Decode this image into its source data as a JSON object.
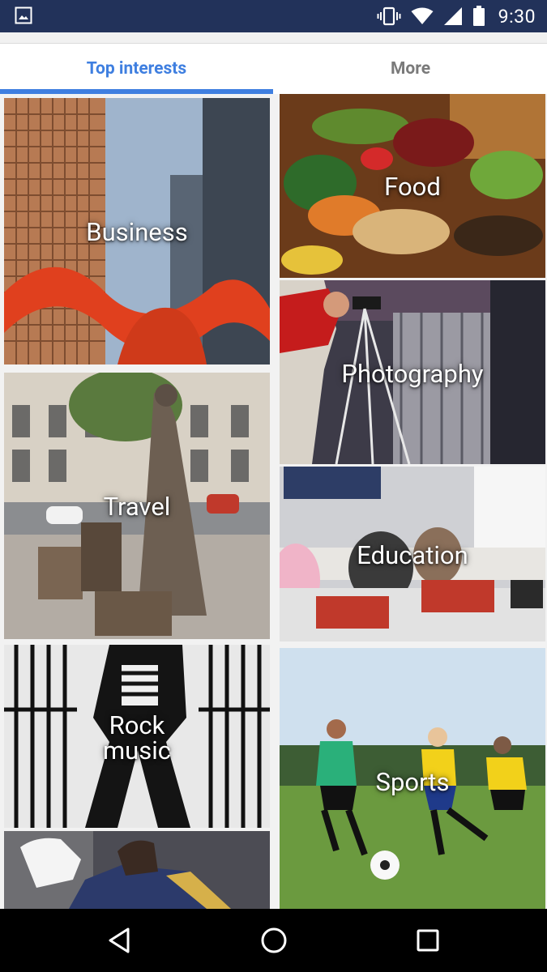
{
  "status_bar": {
    "time": "9:30",
    "left_icon": "image-notification-icon",
    "right_icons": [
      "vibrate-icon",
      "wifi-icon",
      "signal-icon",
      "battery-icon"
    ]
  },
  "tabs": [
    {
      "label": "Top interests",
      "active": true
    },
    {
      "label": "More",
      "active": false
    }
  ],
  "colors": {
    "accent": "#3f7fe0",
    "status_bar": "#22325a",
    "inactive_tab": "#7a7a7a"
  },
  "tiles": {
    "business": "Business",
    "travel": "Travel",
    "rock_music": "Rock\nmusic",
    "food": "Food",
    "photography": "Photography",
    "education": "Education",
    "sports": "Sports"
  },
  "nav_bar": {
    "buttons": [
      "back-icon",
      "home-icon",
      "recents-icon"
    ]
  }
}
